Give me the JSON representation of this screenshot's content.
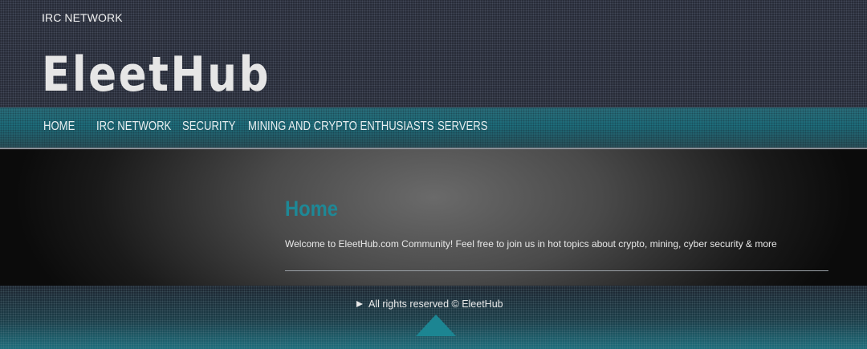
{
  "header": {
    "tagline": "IRC NETWORK",
    "site_title": "EleetHub"
  },
  "nav": {
    "items": [
      {
        "label": "HOME"
      },
      {
        "label": "IRC NETWORK"
      },
      {
        "label": "SECURITY"
      },
      {
        "label": "MINING AND CRYPTO ENTHUSIASTS"
      },
      {
        "label": "SERVERS"
      }
    ]
  },
  "main": {
    "title": "Home",
    "text": "Welcome to EleetHub.com Community! Feel free to join us in hot topics about crypto, mining, cyber security & more"
  },
  "footer": {
    "copyright": "All rights reserved © EleetHub",
    "arrow_icon": "play-right-icon",
    "top_icon": "arrow-up-icon"
  },
  "colors": {
    "accent": "#1e8896",
    "header_bg": "#272b37",
    "nav_bg": "#1d6c7a"
  }
}
